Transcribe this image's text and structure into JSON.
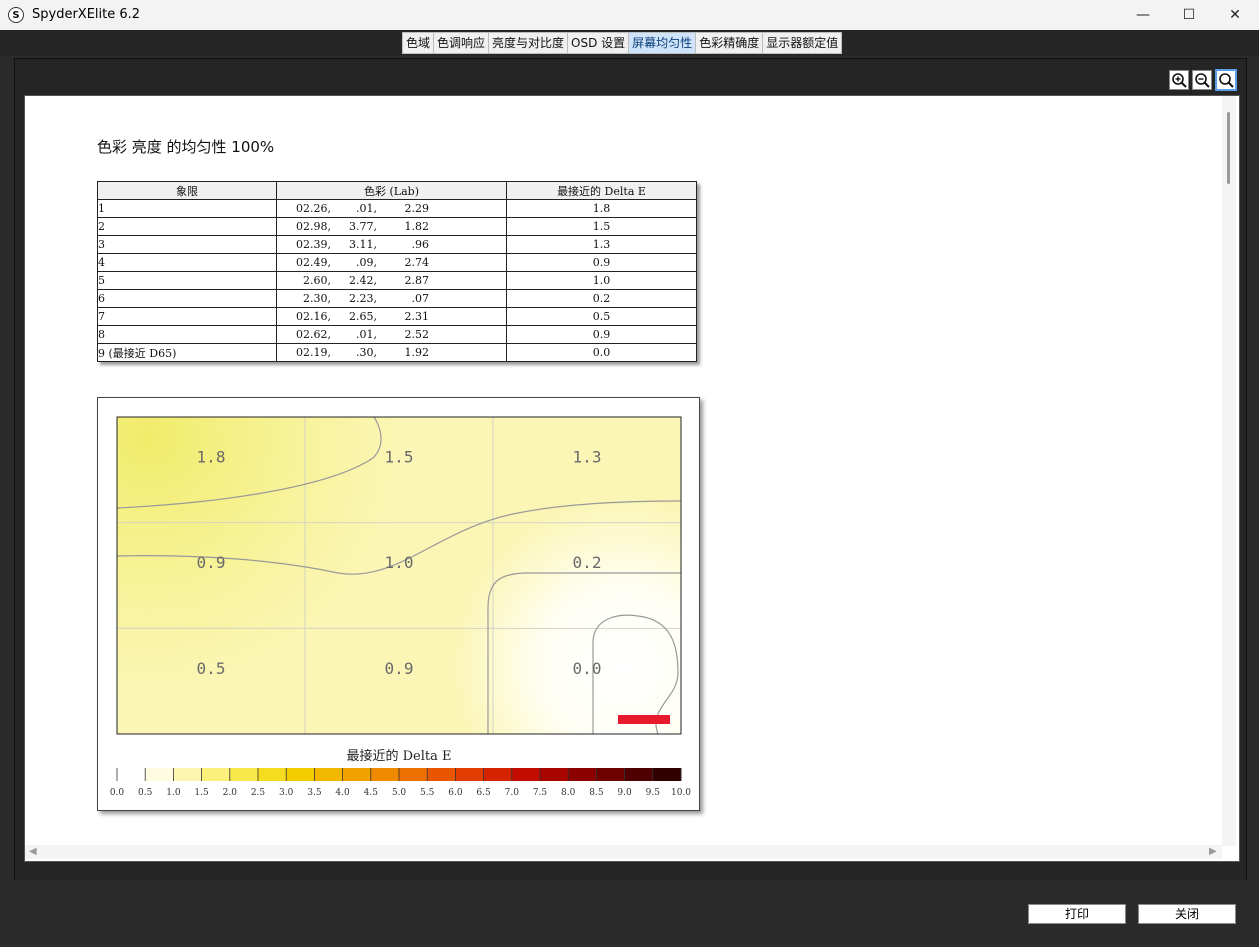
{
  "app": {
    "title": "SpyderXElite 6.2",
    "icon_letter": "S"
  },
  "window_controls": {
    "minimize": "—",
    "maximize": "☐",
    "close": "✕"
  },
  "tabs": [
    {
      "label": "色域",
      "active": false
    },
    {
      "label": "色调响应",
      "active": false
    },
    {
      "label": "亮度与对比度",
      "active": false
    },
    {
      "label": "OSD 设置",
      "active": false
    },
    {
      "label": "屏幕均匀性",
      "active": true
    },
    {
      "label": "色彩精确度",
      "active": false
    },
    {
      "label": "显示器额定值",
      "active": false
    }
  ],
  "zoom_controls": [
    "zoom-in-icon",
    "zoom-out-icon",
    "zoom-fit-icon"
  ],
  "report": {
    "title": "色彩 亮度 的均匀性 100%",
    "table": {
      "headers": [
        "象限",
        "色彩 (Lab)",
        "最接近的 Delta E"
      ],
      "rows": [
        {
          "quadrant": "1",
          "lab": [
            "02.26,",
            ".01,",
            "2.29"
          ],
          "delta_e": "1.8"
        },
        {
          "quadrant": "2",
          "lab": [
            "02.98,",
            "3.77,",
            "1.82"
          ],
          "delta_e": "1.5"
        },
        {
          "quadrant": "3",
          "lab": [
            "02.39,",
            "3.11,",
            ".96"
          ],
          "delta_e": "1.3"
        },
        {
          "quadrant": "4",
          "lab": [
            "02.49,",
            ".09,",
            "2.74"
          ],
          "delta_e": "0.9"
        },
        {
          "quadrant": "5",
          "lab": [
            "2.60,",
            "2.42,",
            "2.87"
          ],
          "delta_e": "1.0"
        },
        {
          "quadrant": "6",
          "lab": [
            "2.30,",
            "2.23,",
            ".07"
          ],
          "delta_e": "0.2"
        },
        {
          "quadrant": "7",
          "lab": [
            "02.16,",
            "2.65,",
            "2.31"
          ],
          "delta_e": "0.5"
        },
        {
          "quadrant": "8",
          "lab": [
            "02.62,",
            ".01,",
            "2.52"
          ],
          "delta_e": "0.9"
        },
        {
          "quadrant": "9 (最接近 D65)",
          "lab": [
            "02.19,",
            ".30,",
            "1.92"
          ],
          "delta_e": "0.0"
        }
      ]
    }
  },
  "chart_data": {
    "type": "heatmap",
    "grid": [
      [
        "1.8",
        "1.5",
        "1.3"
      ],
      [
        "0.9",
        "1.0",
        "0.2"
      ],
      [
        "0.5",
        "0.9",
        "0.0"
      ]
    ],
    "values": [
      [
        1.8,
        1.5,
        1.3
      ],
      [
        0.9,
        1.0,
        0.2
      ],
      [
        0.5,
        0.9,
        0.0
      ]
    ],
    "reference_marker_color": "#e8192c",
    "scale_label": "最接近的 Delta E",
    "scale_ticks": [
      "0.0",
      "0.5",
      "1.0",
      "1.5",
      "2.0",
      "2.5",
      "3.0",
      "3.5",
      "4.0",
      "4.5",
      "5.0",
      "5.5",
      "6.0",
      "6.5",
      "7.0",
      "7.5",
      "8.0",
      "8.5",
      "9.0",
      "9.5",
      "10.0"
    ],
    "scale_colors": [
      "#ffffff",
      "#fffbe0",
      "#fdf6b0",
      "#fbf07c",
      "#f8e84a",
      "#f5dc1e",
      "#f3cc00",
      "#f2b800",
      "#f1a100",
      "#ef8a00",
      "#ec7000",
      "#e85600",
      "#e23c00",
      "#d52300",
      "#c20c00",
      "#a80400",
      "#8c0200",
      "#6e0100",
      "#500000",
      "#330000"
    ],
    "grid_lines": true
  },
  "footer": {
    "print_label": "打印",
    "close_label": "关闭"
  }
}
